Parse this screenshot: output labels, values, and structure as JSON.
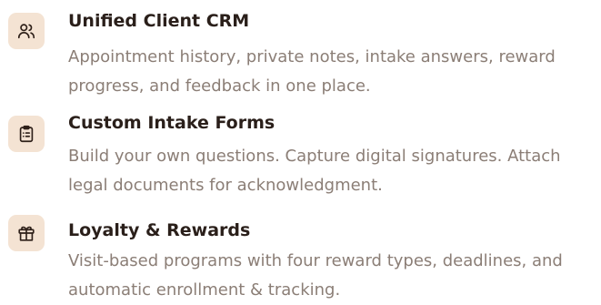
{
  "colors": {
    "badge_bg": "#f4e3d3",
    "icon_stroke": "#2e2019",
    "title": "#2a1f1a",
    "description": "#8b7e76"
  },
  "features": [
    {
      "icon": "users-icon",
      "title": "Unified Client CRM",
      "description": "Appointment history, private notes, intake answers, reward progress, and feedback in one place."
    },
    {
      "icon": "clipboard-list-icon",
      "title": "Custom Intake Forms",
      "description": "Build your own questions. Capture digital signatures. Attach legal documents for acknowledgment."
    },
    {
      "icon": "gift-icon",
      "title": "Loyalty & Rewards",
      "description": "Visit-based programs with four reward types, deadlines, and automatic enrollment & tracking."
    }
  ]
}
